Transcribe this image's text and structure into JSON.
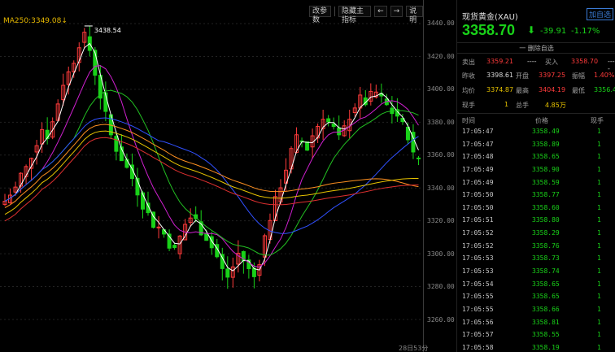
{
  "toolbar": {
    "params_label": "改参数",
    "hide_indicator_label": "隐藏主指标",
    "prev_icon": "←",
    "next_icon": "→",
    "help_label": "说明"
  },
  "ma_label": "MA250:3349.08↓",
  "high_marker": "3438.54",
  "price_axis": {
    "ticks": [
      "3440.00",
      "3420.00",
      "3400.00",
      "3380.00",
      "3360.00",
      "3340.00",
      "3320.00",
      "3300.00",
      "3280.00",
      "3260.00"
    ]
  },
  "bottom_time": "28日53分",
  "quote": {
    "name": "现货黄金(XAU)",
    "follow_label": "加自选",
    "price": "3358.70",
    "arrow": "⬇",
    "change": "-39.91",
    "change_pct": "-1.17%",
    "delete_label": "一 删除自选",
    "sell_label": "卖出",
    "sell_value": "3359.21",
    "sell_vol": "----",
    "buy_label": "买入",
    "buy_value": "3358.70",
    "buy_vol": "----",
    "prev_close_label": "昨收",
    "prev_close": "3398.61",
    "open_label": "开盘",
    "open": "3397.25",
    "amplitude_label": "振幅",
    "amplitude": "1.40%",
    "avg_label": "均价",
    "avg": "3374.87",
    "high_label": "最高",
    "high": "3404.19",
    "low_label": "最低",
    "low": "3356.4",
    "cur_vol_label": "现手",
    "cur_vol": "1",
    "total_vol_label": "总手",
    "total_vol": "4.85万"
  },
  "ticks_header": {
    "time": "时间",
    "price": "价格",
    "vol": "现手"
  },
  "ticks": [
    {
      "time": "17:05:47",
      "price": "3358.49",
      "vol": "1"
    },
    {
      "time": "17:05:47",
      "price": "3358.89",
      "vol": "1"
    },
    {
      "time": "17:05:48",
      "price": "3358.65",
      "vol": "1"
    },
    {
      "time": "17:05:49",
      "price": "3358.90",
      "vol": "1"
    },
    {
      "time": "17:05:49",
      "price": "3358.59",
      "vol": "1"
    },
    {
      "time": "17:05:50",
      "price": "3358.77",
      "vol": "1"
    },
    {
      "time": "17:05:50",
      "price": "3358.60",
      "vol": "1"
    },
    {
      "time": "17:05:51",
      "price": "3358.80",
      "vol": "1"
    },
    {
      "time": "17:05:52",
      "price": "3358.29",
      "vol": "1"
    },
    {
      "time": "17:05:52",
      "price": "3358.76",
      "vol": "1"
    },
    {
      "time": "17:05:53",
      "price": "3358.73",
      "vol": "1"
    },
    {
      "time": "17:05:53",
      "price": "3358.74",
      "vol": "1"
    },
    {
      "time": "17:05:54",
      "price": "3358.65",
      "vol": "1"
    },
    {
      "time": "17:05:55",
      "price": "3358.65",
      "vol": "1"
    },
    {
      "time": "17:05:55",
      "price": "3358.66",
      "vol": "1"
    },
    {
      "time": "17:05:56",
      "price": "3358.81",
      "vol": "1"
    },
    {
      "time": "17:05:57",
      "price": "3358.55",
      "vol": "1"
    },
    {
      "time": "17:05:58",
      "price": "3358.19",
      "vol": "1"
    }
  ],
  "colors": {
    "up": "#ff3b3b",
    "down": "#19d219",
    "ma_white": "#ffffff",
    "ma_yellow": "#e6c200",
    "ma_magenta": "#d020d0",
    "ma_green": "#22c022",
    "ma_blue": "#3050ff",
    "ma_orange": "#ff9020",
    "ma_red": "#e03030"
  }
}
